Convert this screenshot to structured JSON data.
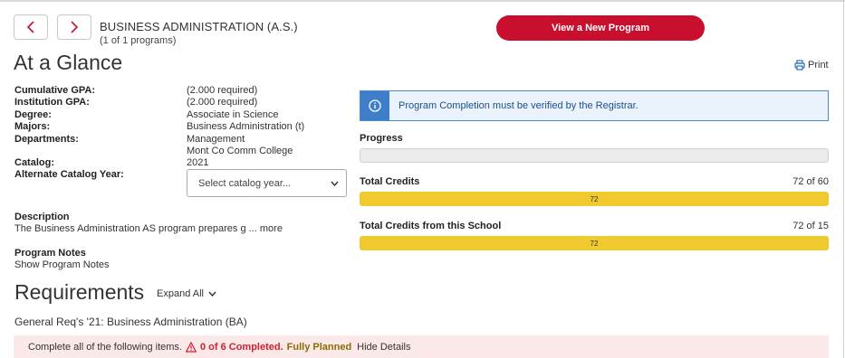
{
  "header": {
    "program_title": "BUSINESS ADMINISTRATION (A.S.)",
    "program_count": "(1 of 1 programs)",
    "new_program_button": "View a New Program"
  },
  "glance": {
    "title": "At a Glance",
    "print_label": "Print",
    "fields": [
      {
        "label": "Cumulative GPA:",
        "value": "(2.000 required)"
      },
      {
        "label": "Institution GPA:",
        "value": "(2.000 required)"
      },
      {
        "label": "Degree:",
        "value": "Associate in Science"
      },
      {
        "label": "Majors:",
        "value": "Business Administration (t)"
      },
      {
        "label": "Departments:",
        "value": "Management"
      },
      {
        "label": "",
        "value": "Mont Co Comm College"
      },
      {
        "label": "Catalog:",
        "value": "2021"
      },
      {
        "label": "Alternate Catalog Year:",
        "value": ""
      }
    ],
    "catalog_select_placeholder": "Select catalog year...",
    "description_label": "Description",
    "description_text": "The Business Administration AS program prepares g ...",
    "description_more": "more",
    "notes_label": "Program Notes",
    "notes_link": "Show Program Notes"
  },
  "progress": {
    "info_message": "Program Completion must be verified by the Registrar.",
    "progress_label": "Progress",
    "total_credits_label": "Total Credits",
    "total_credits_value": "72 of 60",
    "total_credits_bar": "72",
    "school_credits_label": "Total Credits from this School",
    "school_credits_value": "72 of 15",
    "school_credits_bar": "72"
  },
  "requirements": {
    "title": "Requirements",
    "expand_label": "Expand All",
    "group_title": "General Req's '21: Business Administration (BA)",
    "status_text": "Complete all of the following items.",
    "completed_text": "0 of 6 Completed.",
    "planned_text": "Fully Planned",
    "hide_details": "Hide Details"
  },
  "colors": {
    "accent_red": "#c8102e",
    "info_blue": "#3f7fca",
    "bar_yellow": "#f0c92e"
  }
}
